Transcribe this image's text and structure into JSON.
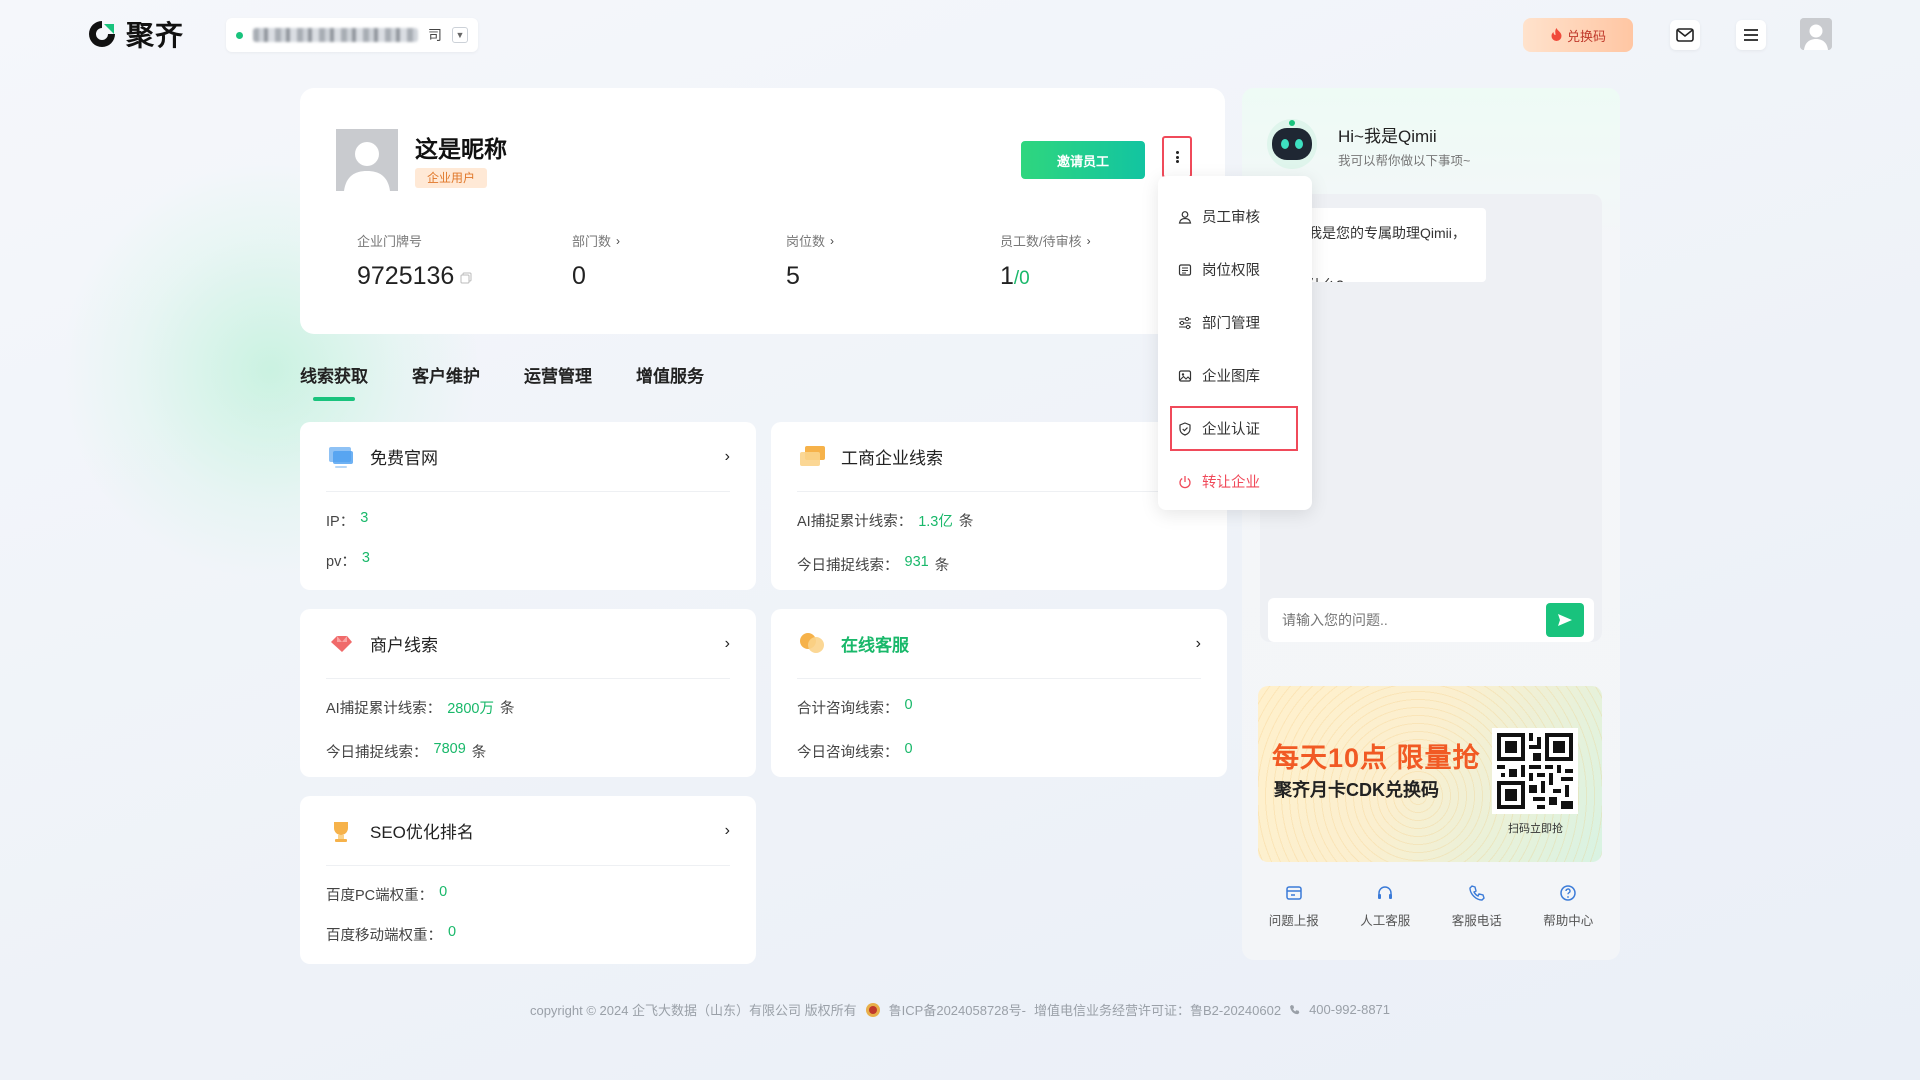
{
  "header": {
    "brand": "聚齐",
    "org_name_suffix": "司",
    "redeem_label": "兑换码",
    "icons": [
      "mail-icon",
      "menu-icon",
      "user-avatar"
    ]
  },
  "profile": {
    "nickname": "这是昵称",
    "role_badge": "企业用户",
    "invite_label": "邀请员工",
    "stats": [
      {
        "label": "企业门牌号",
        "value": "9725136",
        "has_copy": true
      },
      {
        "label": "部门数",
        "value": "0",
        "has_arrow": true
      },
      {
        "label": "岗位数",
        "value": "5",
        "has_arrow": true
      },
      {
        "label": "员工数/待审核",
        "value": "1",
        "secondary": "/0",
        "has_arrow": true
      }
    ]
  },
  "tabs": [
    {
      "label": "线索获取",
      "active": true
    },
    {
      "label": "客户维护",
      "active": false
    },
    {
      "label": "运营管理",
      "active": false
    },
    {
      "label": "增值服务",
      "active": false
    }
  ],
  "cards": {
    "free_site": {
      "title": "免费官网",
      "rows": [
        {
          "label": "IP：",
          "value": "3"
        },
        {
          "label": "pv：",
          "value": "3"
        }
      ]
    },
    "business_leads": {
      "title": "工商企业线索",
      "rows": [
        {
          "label": "AI捕捉累计线索：",
          "value": "1.3亿",
          "unit": "条"
        },
        {
          "label": "今日捕捉线索：",
          "value": "931",
          "unit": "条"
        }
      ]
    },
    "merchant_leads": {
      "title": "商户线索",
      "rows": [
        {
          "label": "AI捕捉累计线索：",
          "value": "2800万",
          "unit": "条"
        },
        {
          "label": "今日捕捉线索：",
          "value": "7809",
          "unit": "条"
        }
      ]
    },
    "online_service": {
      "title": "在线客服",
      "rows": [
        {
          "label": "合计咨询线索：",
          "value": "0"
        },
        {
          "label": "今日咨询线索：",
          "value": "0"
        }
      ]
    },
    "seo": {
      "title": "SEO优化排名",
      "rows": [
        {
          "label": "百度PC端权重：",
          "value": "0"
        },
        {
          "label": "百度移动端权重：",
          "value": "0"
        }
      ]
    }
  },
  "dropdown": {
    "items": [
      {
        "label": "员工审核",
        "icon": "user-icon"
      },
      {
        "label": "岗位权限",
        "icon": "id-card-icon"
      },
      {
        "label": "部门管理",
        "icon": "sliders-icon"
      },
      {
        "label": "企业图库",
        "icon": "image-icon"
      },
      {
        "label": "企业认证",
        "icon": "shield-check-icon",
        "highlighted": true
      },
      {
        "label": "转让企业",
        "icon": "power-icon",
        "danger": true
      }
    ]
  },
  "assistant": {
    "greeting": "Hi~我是Qimii",
    "subtitle": "我可以帮你做以下事项~",
    "bubble_line1": "好，我是您的专属助理Qimii，我",
    "bubble_line2": "聊点什么?",
    "input_placeholder": "请输入您的问题..",
    "promo": {
      "headline": "每天10点 限量抢",
      "subline": "聚齐月卡CDK兑换码",
      "qr_caption": "扫码立即抢"
    },
    "bottom_nav": [
      {
        "label": "问题上报",
        "icon": "report-icon"
      },
      {
        "label": "人工客服",
        "icon": "headset-icon"
      },
      {
        "label": "客服电话",
        "icon": "phone-icon"
      },
      {
        "label": "帮助中心",
        "icon": "help-icon"
      }
    ]
  },
  "footer": {
    "copyright": "copyright © 2024 企飞大数据（山东）有限公司 版权所有",
    "icp": "鲁ICP备2024058728号-",
    "license": "增值电信业务经营许可证：鲁B2-20240602",
    "phone": "400-992-8871"
  },
  "colors": {
    "accent": "#19c37d",
    "danger": "#f04a5a",
    "highlight": "#f15a24"
  }
}
